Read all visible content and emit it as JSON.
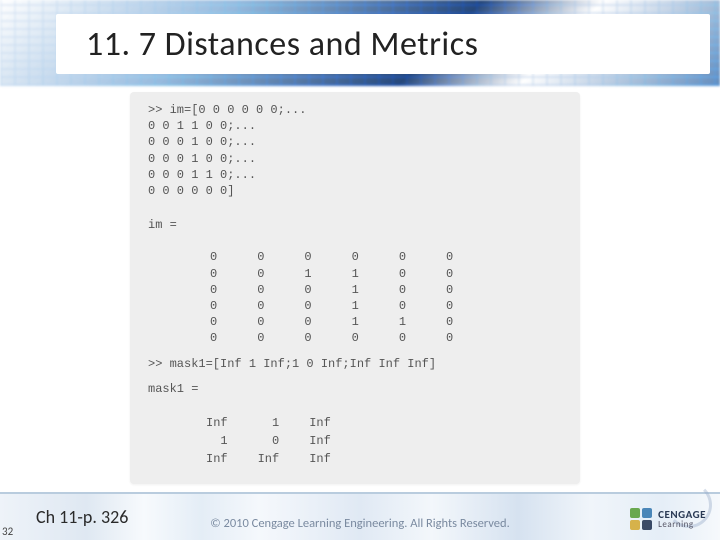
{
  "title": "11. 7 Distances and Metrics",
  "footer": {
    "page_ref": "Ch 11-p. 326",
    "copyright": "© 2010 Cengage Learning Engineering. All Rights Reserved.",
    "page_number": "32",
    "brand": {
      "name": "CENGAGE",
      "sub": "Learning"
    }
  },
  "code": {
    "im_input_lines": [
      ">> im=[0 0 0 0 0 0;...",
      "0 0 1 1 0 0;...",
      "0 0 0 1 0 0;...",
      "0 0 0 1 0 0;...",
      "0 0 0 1 1 0;...",
      "0 0 0 0 0 0]"
    ],
    "im_var": "im =",
    "im_matrix": [
      [
        0,
        0,
        0,
        0,
        0,
        0
      ],
      [
        0,
        0,
        1,
        1,
        0,
        0
      ],
      [
        0,
        0,
        0,
        1,
        0,
        0
      ],
      [
        0,
        0,
        0,
        1,
        0,
        0
      ],
      [
        0,
        0,
        0,
        1,
        1,
        0
      ],
      [
        0,
        0,
        0,
        0,
        0,
        0
      ]
    ],
    "mask_input": ">> mask1=[Inf 1 Inf;1 0 Inf;Inf Inf Inf]",
    "mask_var": "mask1 =",
    "mask_matrix": [
      [
        "Inf",
        "1",
        "Inf"
      ],
      [
        "1",
        "0",
        "Inf"
      ],
      [
        "Inf",
        "Inf",
        "Inf"
      ]
    ]
  }
}
